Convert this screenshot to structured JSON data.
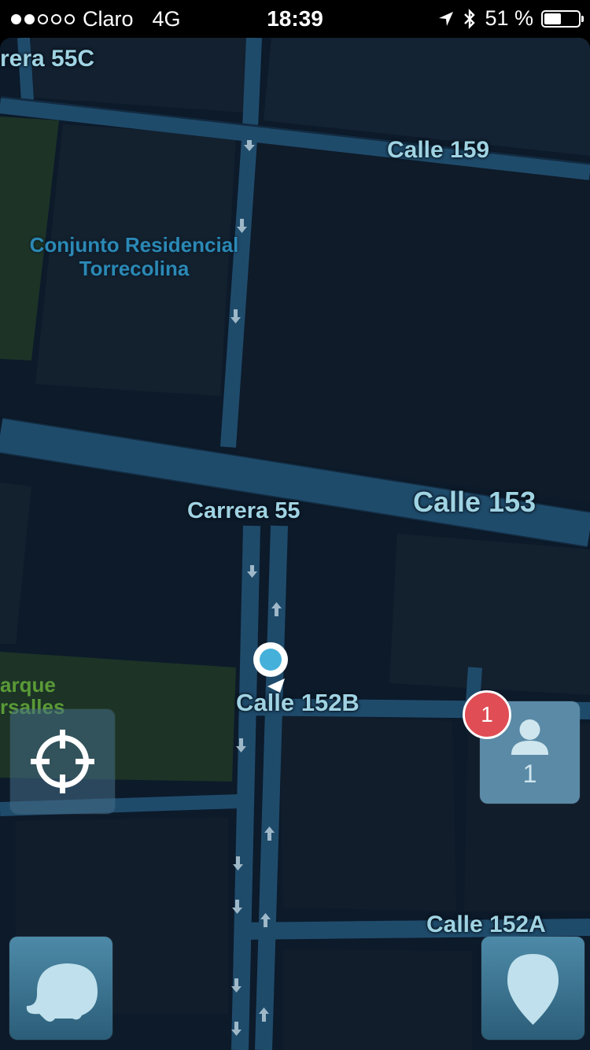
{
  "status_bar": {
    "signal_dots_filled": 2,
    "signal_dots_total": 5,
    "carrier": "Claro",
    "network": "4G",
    "time": "18:39",
    "battery": "51 %",
    "battery_level": 0.51
  },
  "map": {
    "streets": {
      "carrera_55c": "rera 55C",
      "calle_159": "Calle 159",
      "calle_153": "Calle 153",
      "carrera_55": "Carrera 55",
      "calle_152b": "Calle 152B",
      "calle_152a": "Calle 152A"
    },
    "places": {
      "conjunto_line1": "Conjunto Residencial",
      "conjunto_line2": "Torrecolina",
      "park_line1": "arque",
      "park_line2": "rsalles"
    }
  },
  "controls": {
    "locate_icon": "crosshair-icon",
    "users_icon": "person-icon",
    "users_count": "1",
    "notification_badge": "1",
    "menu_icon": "waze-icon",
    "report_icon": "map-pin-icon"
  },
  "colors": {
    "map_background": "#0c1a2a",
    "road": "#1f4b6b",
    "block": "#12202f",
    "park": "#1c3326",
    "badge": "#e04d55",
    "accent": "#45b1da"
  }
}
